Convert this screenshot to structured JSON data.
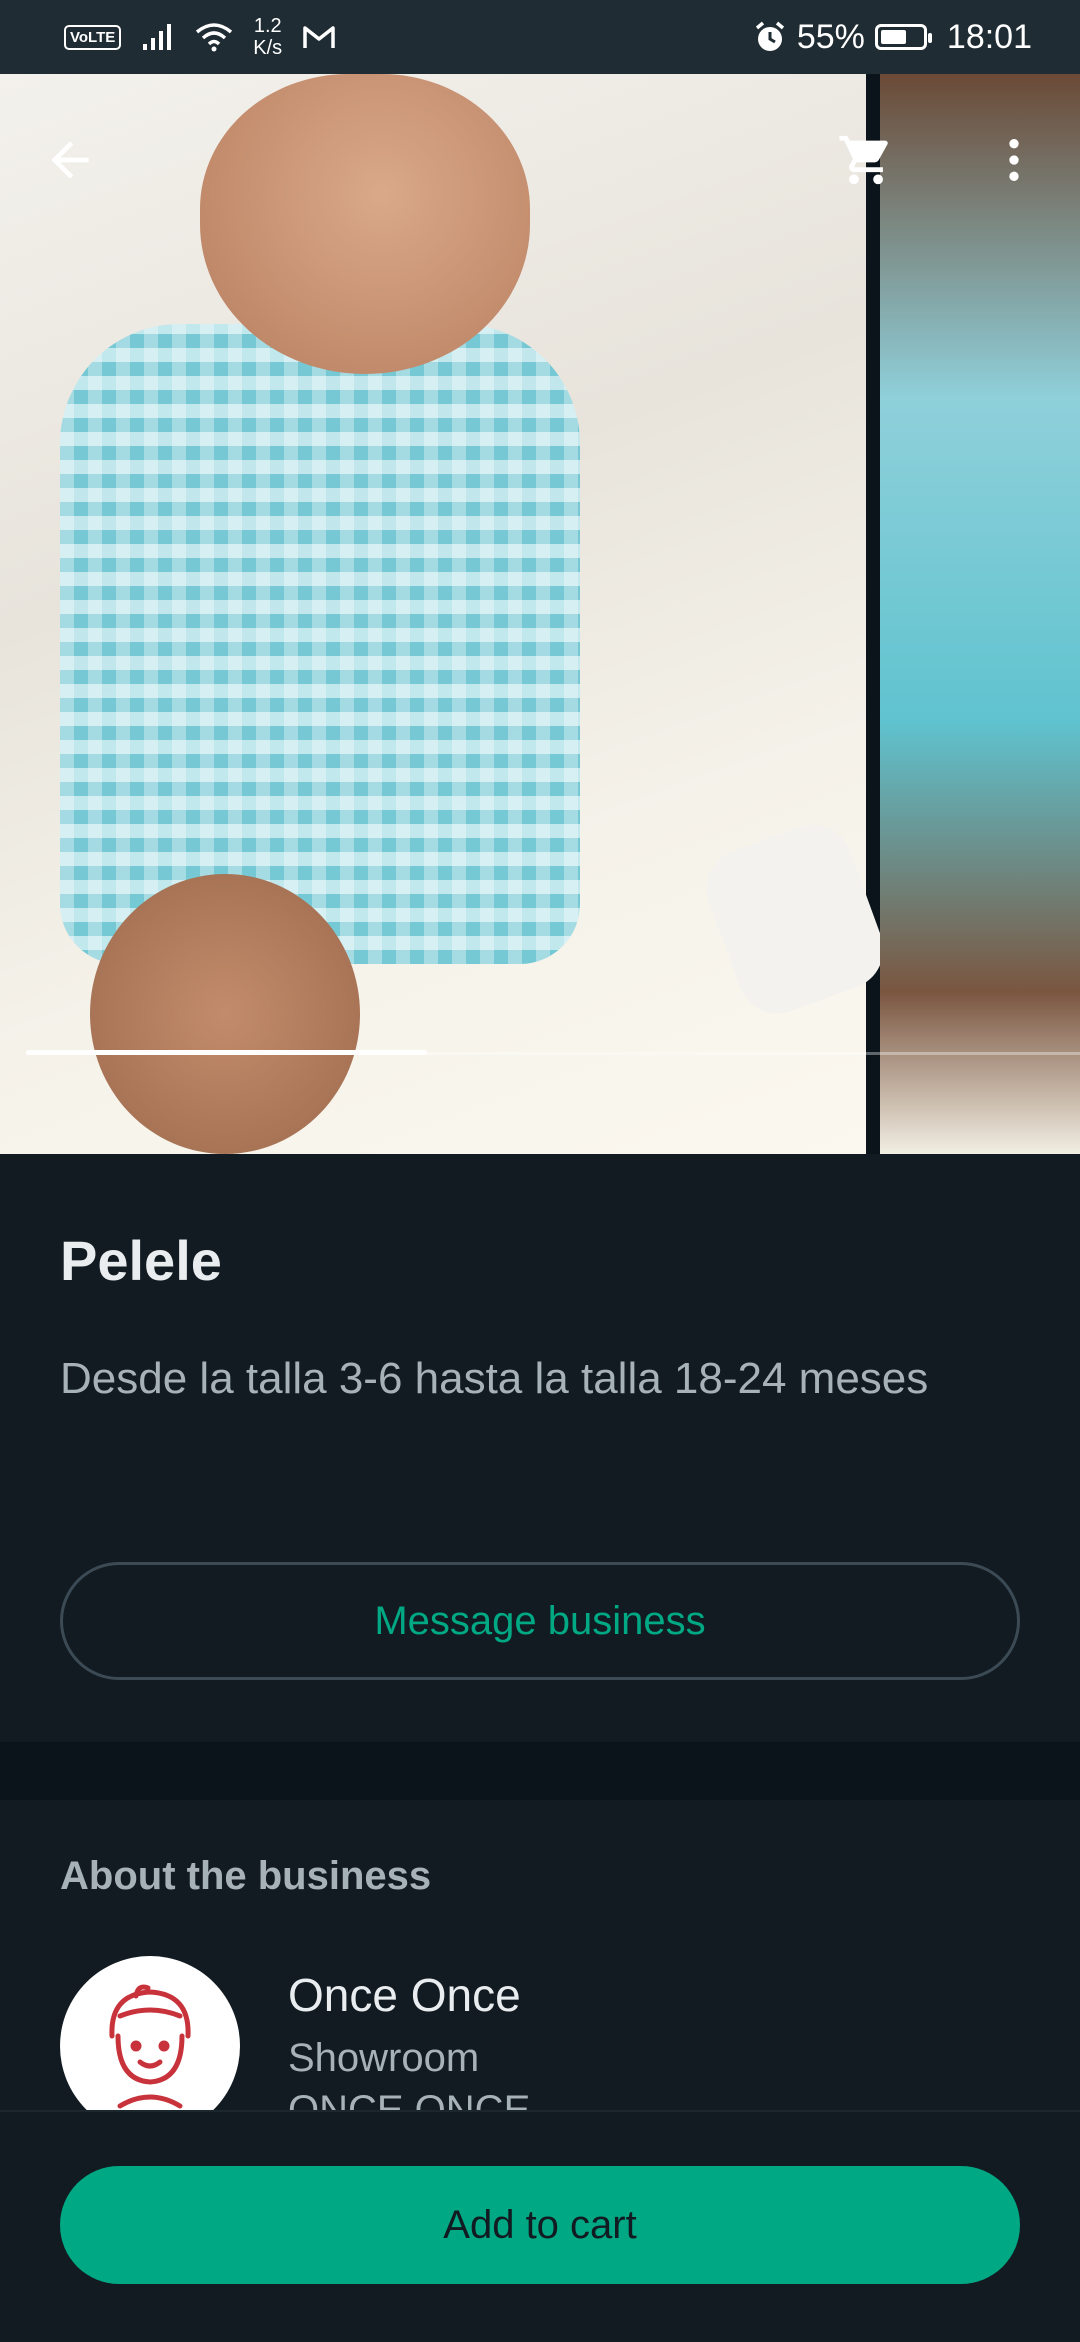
{
  "status_bar": {
    "volte": "VoLTE",
    "net_speed_value": "1.2",
    "net_speed_unit": "K/s",
    "battery_percent": "55%",
    "time": "18:01"
  },
  "gallery": {
    "progress_fraction": 0.38
  },
  "product": {
    "title": "Pelele",
    "description": "Desde la talla 3-6 hasta la talla 18-24 meses",
    "message_button": "Message business"
  },
  "business": {
    "section_title": "About the business",
    "name": "Once Once",
    "subtitle_line1": "Showroom",
    "subtitle_line2": "ONCE ONCE"
  },
  "actions": {
    "add_to_cart": "Add to cart"
  },
  "colors": {
    "accent": "#00a884",
    "background": "#111b21"
  },
  "icons": [
    "back-arrow-icon",
    "cart-icon",
    "more-vert-icon",
    "signal-icon",
    "wifi-icon",
    "gmail-icon",
    "alarm-icon",
    "battery-icon"
  ]
}
